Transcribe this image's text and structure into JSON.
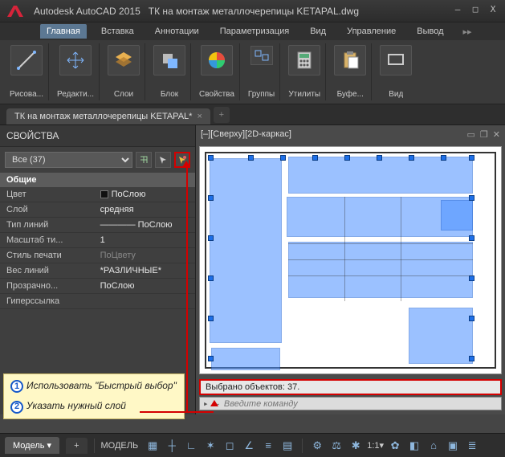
{
  "titlebar": {
    "app": "Autodesk AutoCAD 2015",
    "doc": "ТК на монтаж металлочерепицы KETAPAL.dwg"
  },
  "menu": {
    "items": [
      "Главная",
      "Вставка",
      "Аннотации",
      "Параметризация",
      "Вид",
      "Управление",
      "Вывод"
    ],
    "active": 0
  },
  "ribbon": {
    "draw": "Рисова...",
    "edit": "Редакти...",
    "layers": "Слои",
    "block": "Блок",
    "props": "Свойства",
    "groups": "Группы",
    "utils": "Утилиты",
    "clip": "Буфе...",
    "view": "Вид"
  },
  "doctab": {
    "name": "ТК на монтаж металлочерепицы KETAPAL*"
  },
  "panel": {
    "title": "СВОЙСТВА",
    "selection": "Все (37)",
    "section": "Общие",
    "rows": [
      {
        "k": "Цвет",
        "v": "ПоСлою"
      },
      {
        "k": "Слой",
        "v": "средняя"
      },
      {
        "k": "Тип линий",
        "v": "———— ПоСлою"
      },
      {
        "k": "Масштаб ти...",
        "v": "1"
      },
      {
        "k": "Стиль печати",
        "v": "ПоЦвету"
      },
      {
        "k": "Вес линий",
        "v": "*РАЗЛИЧНЫЕ*"
      },
      {
        "k": "Прозрачно...",
        "v": "ПоСлою"
      },
      {
        "k": "Гиперссылка",
        "v": ""
      }
    ]
  },
  "callout": {
    "n1": "1",
    "t1": "Использовать \"Быстрый выбор\"",
    "n2": "2",
    "t2": "Указать нужный слой"
  },
  "view": {
    "label": "[–][Сверху][2D-каркас]"
  },
  "cmd": {
    "output": "Выбрано объектов: 37.",
    "placeholder": "Введите команду",
    "prompt": "▸ –"
  },
  "status": {
    "model_tab": "Модель",
    "model_label": "МОДЕЛЬ",
    "scale": "1:1"
  }
}
